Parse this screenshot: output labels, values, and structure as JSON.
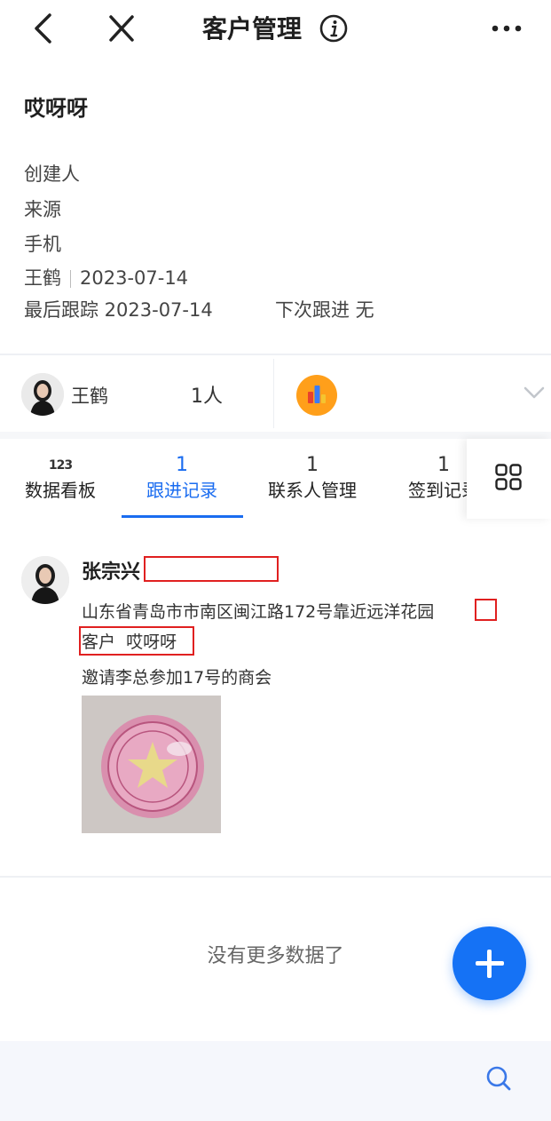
{
  "nav": {
    "title": "客户管理",
    "back_icon": "chevron-left-icon",
    "close_icon": "close-icon",
    "info_icon": "info-icon",
    "more_icon": "more-icon"
  },
  "customer": {
    "name": "哎呀呀",
    "creator_label": "创建人",
    "source_label": "来源",
    "phone_label": "手机",
    "created_by": "王鹤",
    "created_date": "2023-07-14",
    "last_follow": "最后跟踪 2023-07-14",
    "next_follow": "下次跟进 无"
  },
  "owner": {
    "name": "王鹤",
    "count": "1人"
  },
  "tabs": [
    {
      "num": "123",
      "label": "数据看板"
    },
    {
      "num": "1",
      "label": "跟进记录"
    },
    {
      "num": "1",
      "label": "联系人管理"
    },
    {
      "num": "1",
      "label": "签到记录"
    }
  ],
  "record": {
    "name": "张宗兴",
    "address": "山东省青岛市市南区闽江路172号靠近远洋花园",
    "customer_tag": "客户",
    "customer_name": "哎呀呀",
    "note": "邀请李总参加17号的商会"
  },
  "footer": {
    "no_more": "没有更多数据了"
  },
  "colors": {
    "accent": "#1a6cf0",
    "fab": "#1572f5",
    "annotation": "#e02020"
  }
}
